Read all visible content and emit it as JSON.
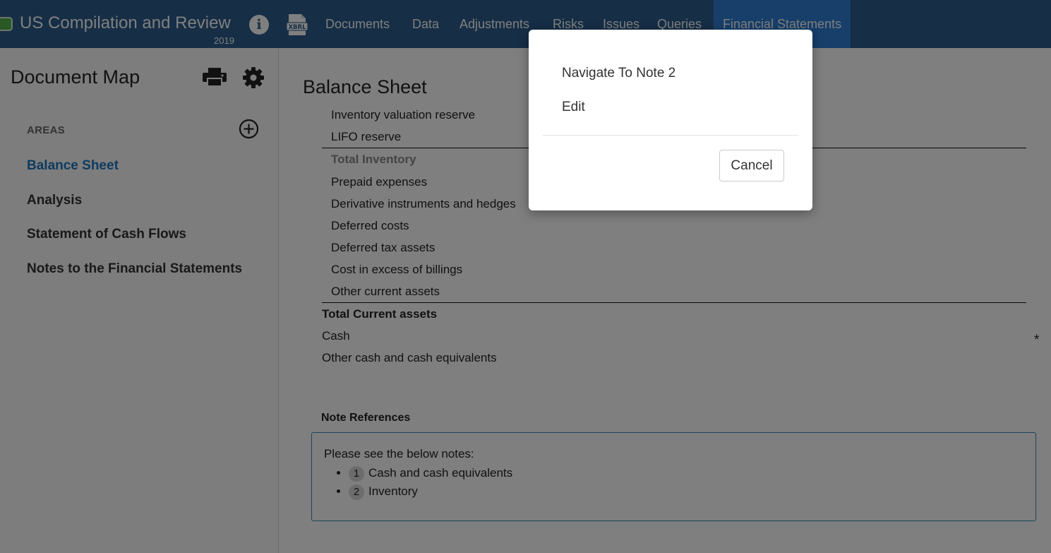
{
  "header": {
    "app_title": "US Compilation and Review",
    "year": "2019",
    "info_icon": "info-icon",
    "xbrl_icon_label": "XBRL",
    "nav_tabs": [
      {
        "label": "Documents"
      },
      {
        "label": "Data"
      },
      {
        "label": "Adjustments"
      },
      {
        "label": "Risks"
      },
      {
        "label": "Issues"
      },
      {
        "label": "Queries"
      },
      {
        "label": "Financial Statements",
        "active": true
      }
    ],
    "colors": {
      "bar": "#2c5d8c",
      "active_tab": "#2f7fd4"
    }
  },
  "sidebar": {
    "title": "Document Map",
    "areas_label": "AREAS",
    "items": [
      {
        "label": "Balance Sheet",
        "selected": true
      },
      {
        "label": "Analysis"
      },
      {
        "label": "Statement of Cash Flows"
      },
      {
        "label": "Notes to the Financial Statements"
      }
    ],
    "icons": [
      "print-icon",
      "gear-icon",
      "add-circle-icon"
    ]
  },
  "main": {
    "title": "Balance Sheet",
    "rows": [
      {
        "label": "Inventory valuation reserve"
      },
      {
        "label": "LIFO reserve"
      },
      {
        "label": "Total Inventory"
      },
      {
        "label": "Prepaid expenses"
      },
      {
        "label": "Derivative instruments and hedges"
      },
      {
        "label": "Deferred costs"
      },
      {
        "label": "Deferred tax assets"
      },
      {
        "label": "Cost in excess of billings"
      },
      {
        "label": "Other current assets"
      },
      {
        "label": "Total Current assets"
      },
      {
        "label": "Cash"
      },
      {
        "label": "Other cash and cash equivalents"
      }
    ],
    "asterisk": "*",
    "note_references": {
      "label": "Note References",
      "intro": "Please see the below notes:",
      "notes": [
        {
          "number": "1",
          "text": "Cash and cash equivalents"
        },
        {
          "number": "2",
          "text": "Inventory"
        }
      ]
    }
  },
  "modal": {
    "items": [
      {
        "label": "Navigate To Note 2"
      },
      {
        "label": "Edit"
      }
    ],
    "cancel_label": "Cancel"
  }
}
